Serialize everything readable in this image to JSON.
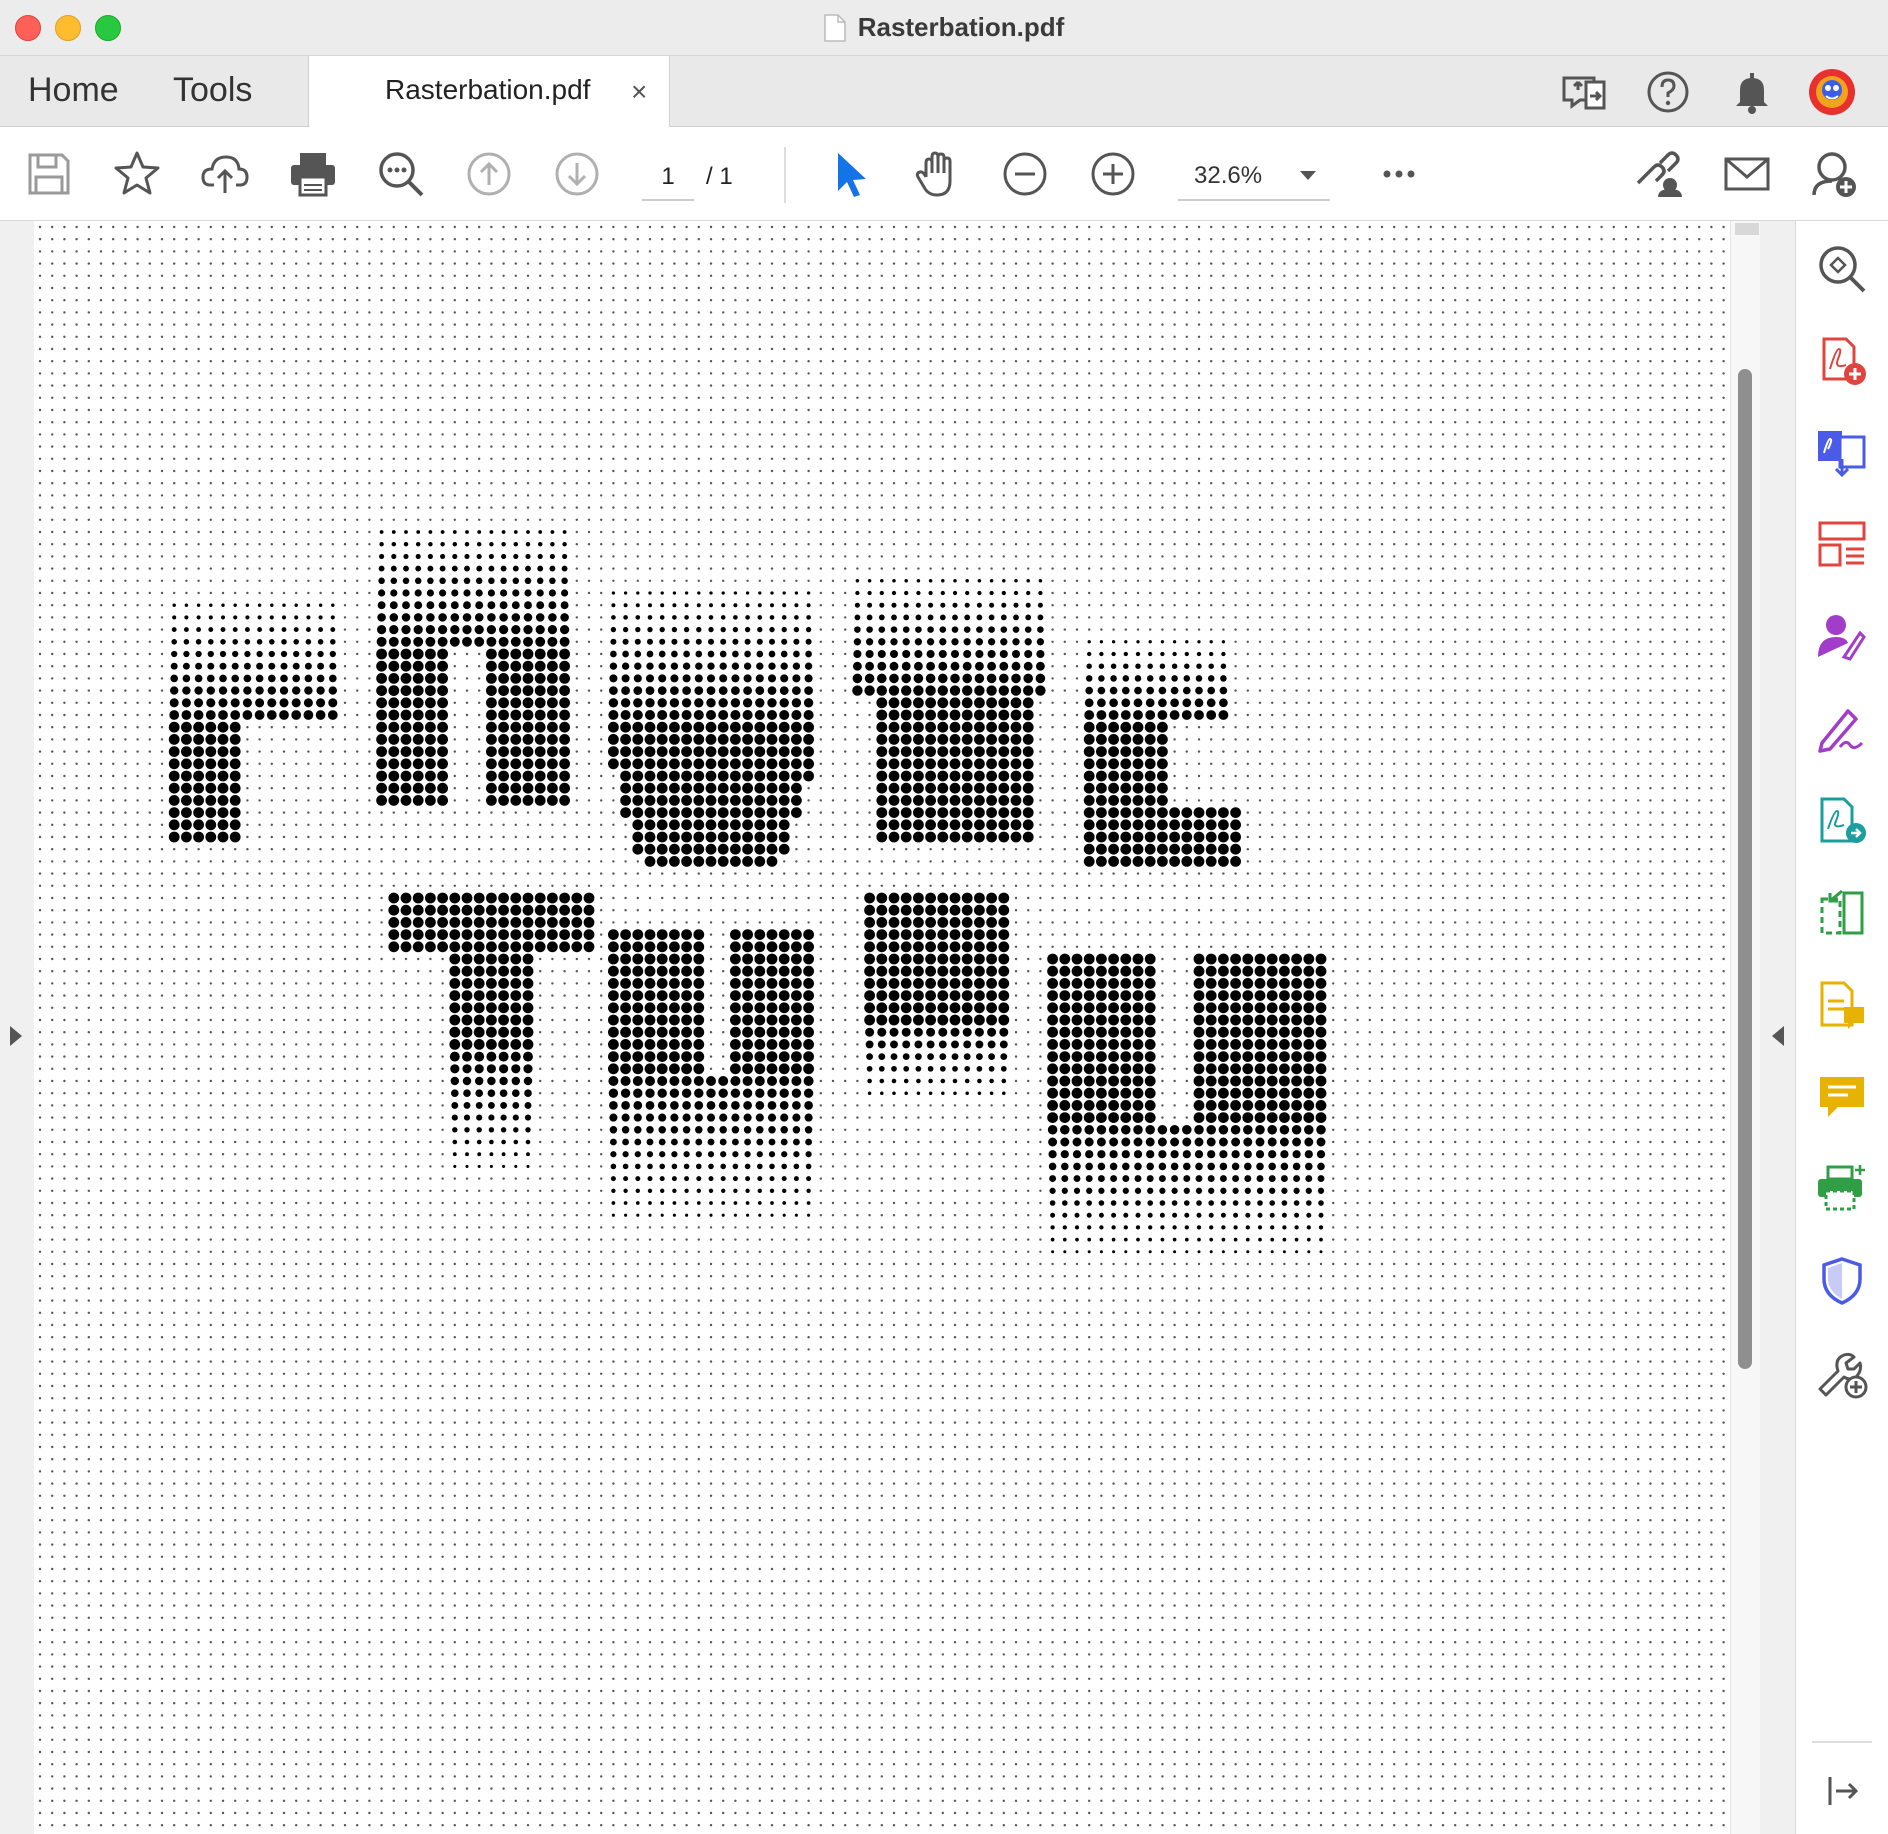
{
  "window": {
    "title": "Rasterbation.pdf",
    "title_icon": "document-icon"
  },
  "tabs": {
    "home": "Home",
    "tools": "Tools",
    "document": "Rasterbation.pdf",
    "close": "×"
  },
  "top_right_icons": [
    "share-screen-icon",
    "help-icon",
    "notifications-bell-icon",
    "user-avatar"
  ],
  "toolbar": {
    "icons": [
      "save-icon",
      "bookmark-star-icon",
      "upload-cloud-icon",
      "print-icon",
      "search-icon",
      "previous-page-icon",
      "next-page-icon",
      "select-pointer-icon",
      "hand-tool-icon",
      "zoom-out-icon",
      "zoom-in-icon",
      "more-options-icon",
      "share-link-icon",
      "email-icon",
      "add-user-icon"
    ],
    "current_page": "1",
    "page_total": "/ 1",
    "zoom": "32.6%",
    "more": "•••"
  },
  "document": {
    "content_description_hidden": "",
    "halftone_words": [
      "PHOTO",
      "TOPH"
    ]
  },
  "right_rail": {
    "icons": [
      "search-document-icon",
      "create-pdf-icon",
      "export-pdf-icon",
      "organize-pages-icon",
      "request-signature-icon",
      "fill-sign-icon",
      "combine-files-icon",
      "edit-pdf-icon",
      "export-pdf-green-icon",
      "comment-icon",
      "scan-enhance-icon",
      "protect-shield-icon",
      "more-tools-icon",
      "collapse-panel-icon"
    ],
    "colors": {
      "red": "#e0443e",
      "blue": "#4a5be8",
      "purple": "#a23dc9",
      "teal": "#1b9e9e",
      "green": "#2f9e44",
      "yellow": "#e8b200",
      "pointer_blue": "#1473e6"
    }
  }
}
